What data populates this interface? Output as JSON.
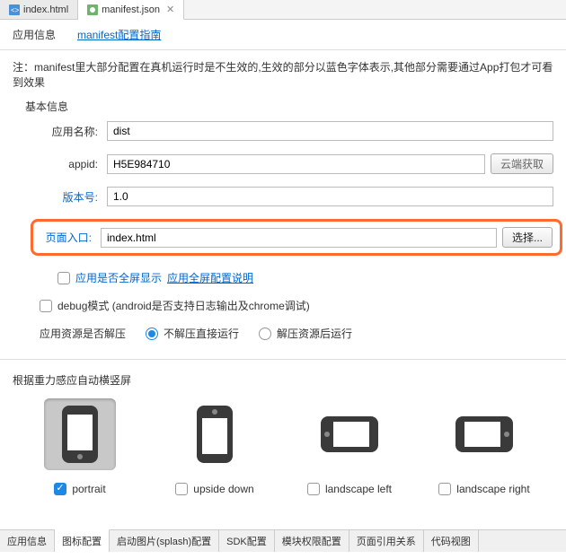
{
  "tabs": {
    "index": "index.html",
    "manifest": "manifest.json"
  },
  "subheader": {
    "app_info": "应用信息",
    "guide_link": "manifest配置指南"
  },
  "note": "注：manifest里大部分配置在真机运行时是不生效的,生效的部分以蓝色字体表示,其他部分需要通过App打包才可看到效果",
  "section_basic": "基本信息",
  "form": {
    "name_label": "应用名称:",
    "name_value": "dist",
    "appid_label": "appid:",
    "appid_value": "H5E984710",
    "cloud_btn": "云端获取",
    "version_label": "版本号:",
    "version_value": "1.0",
    "entry_label": "页面入口:",
    "entry_value": "index.html",
    "select_btn": "选择..."
  },
  "checks": {
    "fullscreen": "应用是否全屏显示",
    "fullscreen_link": "应用全屏配置说明",
    "debug": "debug模式 (android是否支持日志输出及chrome调试)"
  },
  "resource": {
    "label": "应用资源是否解压",
    "opt1": "不解压直接运行",
    "opt2": "解压资源后运行"
  },
  "orientation": {
    "title": "根据重力感应自动横竖屏",
    "portrait": "portrait",
    "upside": "upside down",
    "land_left": "landscape left",
    "land_right": "landscape right"
  },
  "bottom_tabs": [
    "应用信息",
    "图标配置",
    "启动图片(splash)配置",
    "SDK配置",
    "模块权限配置",
    "页面引用关系",
    "代码视图"
  ],
  "watermark": ""
}
